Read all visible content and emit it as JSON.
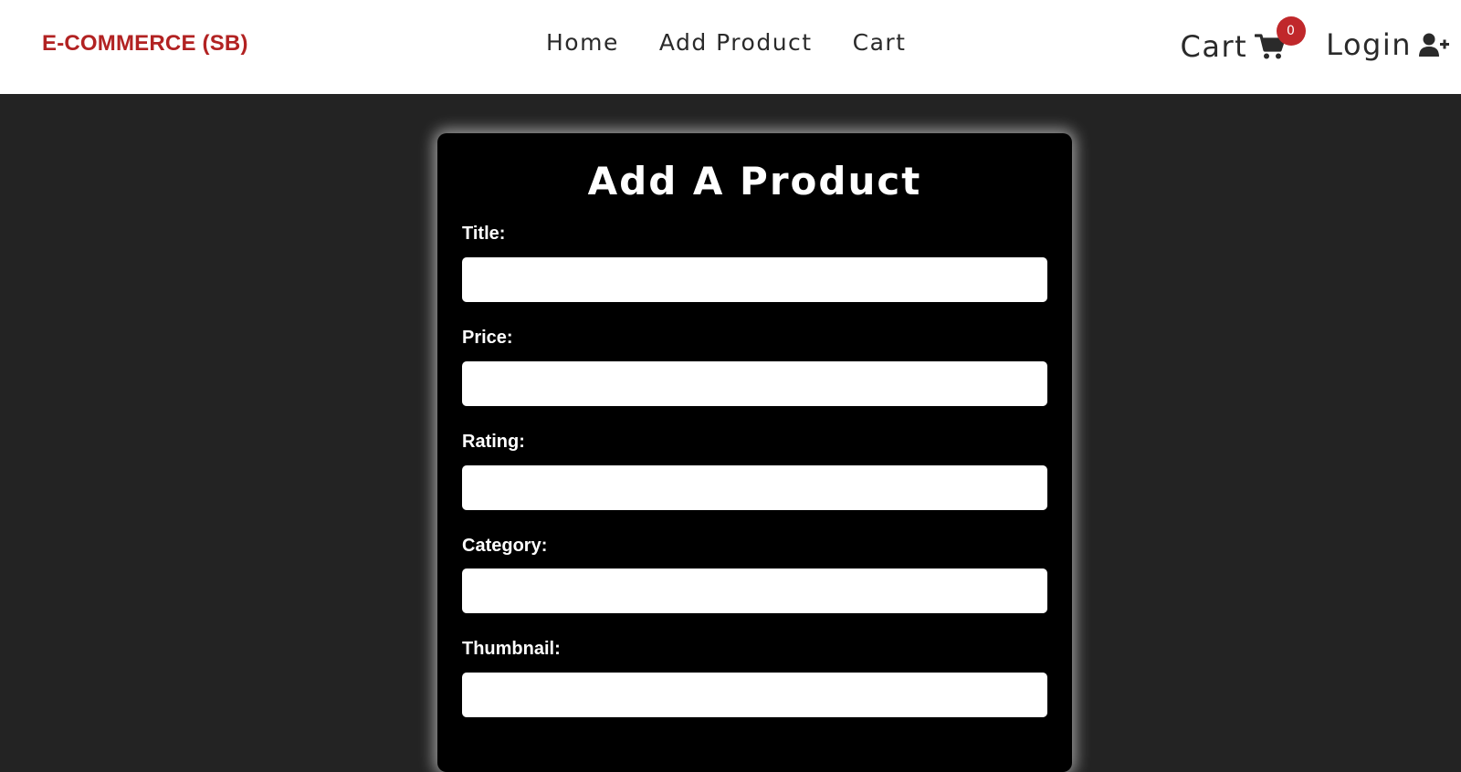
{
  "navbar": {
    "brand": "E-COMMERCE (SB)",
    "links": [
      "Home",
      "Add Product",
      "Cart"
    ],
    "cart_label": "Cart",
    "cart_count": "0",
    "login_label": "Login",
    "brand_color": "#b22222",
    "badge_color": "#c0282b"
  },
  "form": {
    "title": "Add A Product",
    "fields": [
      {
        "label": "Title:",
        "value": "",
        "placeholder": ""
      },
      {
        "label": "Price:",
        "value": "",
        "placeholder": ""
      },
      {
        "label": "Rating:",
        "value": "",
        "placeholder": ""
      },
      {
        "label": "Category:",
        "value": "",
        "placeholder": ""
      },
      {
        "label": "Thumbnail:",
        "value": "",
        "placeholder": ""
      }
    ]
  },
  "icons": {
    "cart": "shopping-cart-icon",
    "login": "user-plus-icon"
  },
  "colors": {
    "page_background": "#232323",
    "card_background": "#000000",
    "navbar_background": "#ffffff"
  }
}
